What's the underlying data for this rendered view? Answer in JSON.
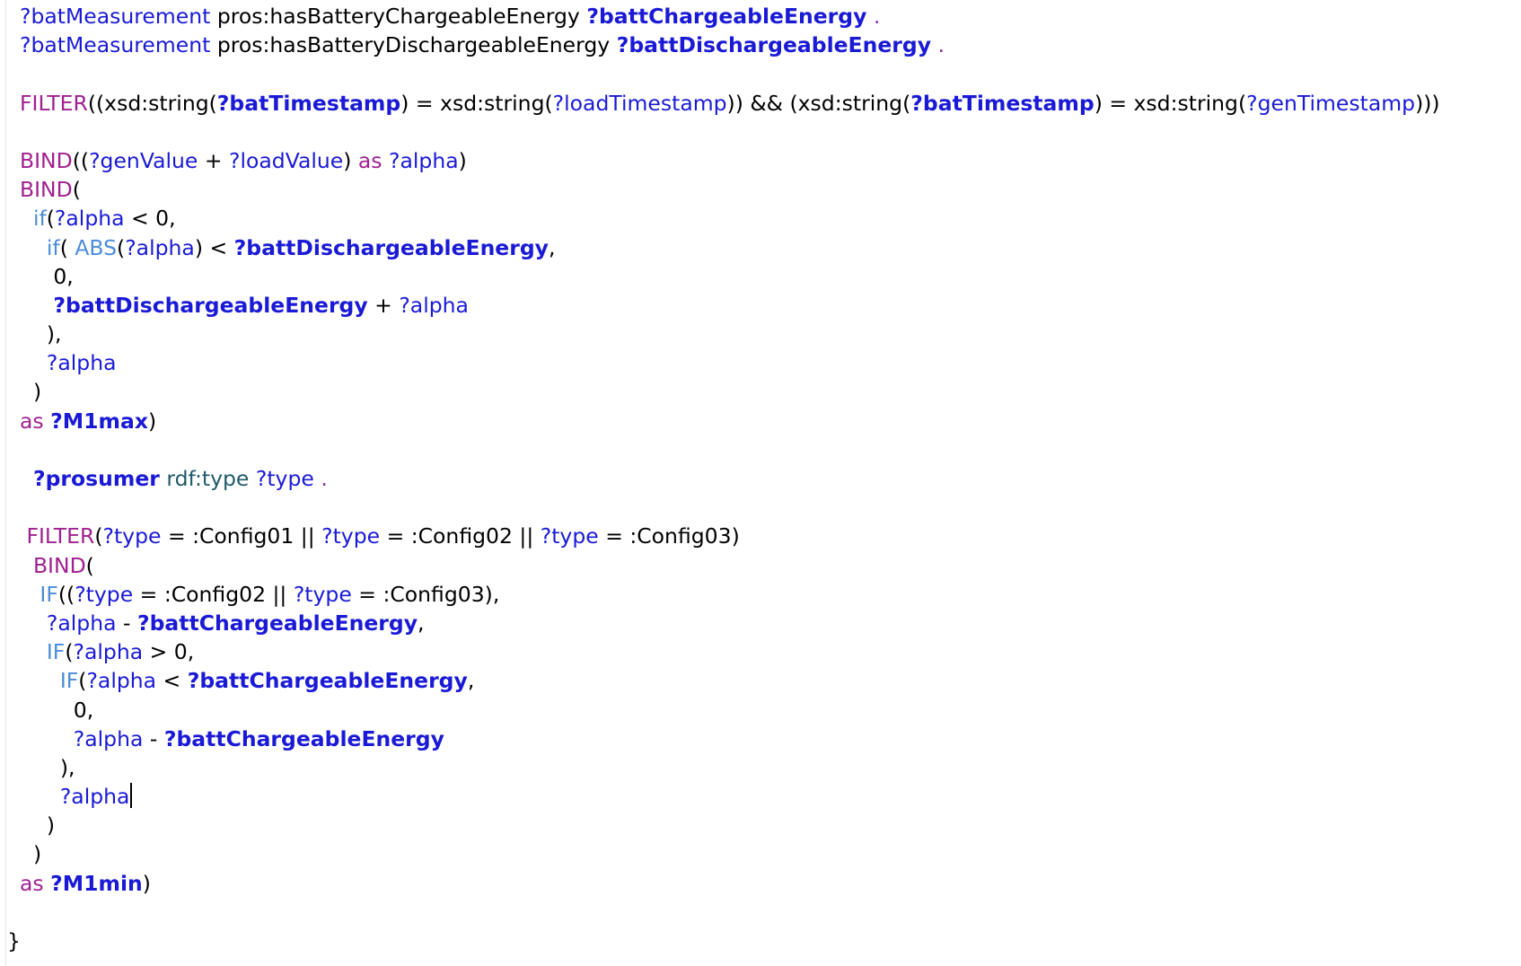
{
  "editor": {
    "lines": [
      [
        {
          "t": "?batMeasurement",
          "c": "pl"
        },
        {
          "t": " pros:hasBatteryChargeableEnergy ",
          "c": "pn"
        },
        {
          "t": "?battChargeableEnergy",
          "c": "bv"
        },
        {
          "t": " .",
          "c": "dot"
        }
      ],
      [
        {
          "t": "?batMeasurement",
          "c": "pl"
        },
        {
          "t": " pros:hasBatteryDischargeableEnergy ",
          "c": "pn"
        },
        {
          "t": "?battDischargeableEnergy",
          "c": "bv"
        },
        {
          "t": " .",
          "c": "dot"
        }
      ],
      [],
      [
        {
          "t": "FILTER",
          "c": "kw"
        },
        {
          "t": "((xsd:string(",
          "c": "pn"
        },
        {
          "t": "?batTimestamp",
          "c": "bv"
        },
        {
          "t": ") = xsd:string(",
          "c": "pn"
        },
        {
          "t": "?loadTimestamp",
          "c": "pl"
        },
        {
          "t": ")) && (xsd:string(",
          "c": "pn"
        },
        {
          "t": "?batTimestamp",
          "c": "bv"
        },
        {
          "t": ") = xsd:string(",
          "c": "pn"
        },
        {
          "t": "?genTimestamp",
          "c": "pl"
        },
        {
          "t": ")))",
          "c": "pn"
        }
      ],
      [],
      [
        {
          "t": "BIND",
          "c": "kw"
        },
        {
          "t": "((",
          "c": "pn"
        },
        {
          "t": "?genValue",
          "c": "pl"
        },
        {
          "t": " + ",
          "c": "pn"
        },
        {
          "t": "?loadValue",
          "c": "pl"
        },
        {
          "t": ") ",
          "c": "pn"
        },
        {
          "t": "as",
          "c": "kw"
        },
        {
          "t": " ",
          "c": "pn"
        },
        {
          "t": "?alpha",
          "c": "pl"
        },
        {
          "t": ")",
          "c": "pn"
        }
      ],
      [
        {
          "t": "BIND",
          "c": "kw"
        },
        {
          "t": "(",
          "c": "pn"
        }
      ],
      [
        {
          "t": "  if",
          "c": "fn"
        },
        {
          "t": "(",
          "c": "pn"
        },
        {
          "t": "?alpha",
          "c": "pl"
        },
        {
          "t": " < 0,",
          "c": "pn"
        }
      ],
      [
        {
          "t": "    if",
          "c": "fn"
        },
        {
          "t": "( ",
          "c": "pn"
        },
        {
          "t": "ABS",
          "c": "fn"
        },
        {
          "t": "(",
          "c": "pn"
        },
        {
          "t": "?alpha",
          "c": "pl"
        },
        {
          "t": ") < ",
          "c": "pn"
        },
        {
          "t": "?battDischargeableEnergy",
          "c": "bv"
        },
        {
          "t": ",",
          "c": "pn"
        }
      ],
      [
        {
          "t": "     0,",
          "c": "pn"
        }
      ],
      [
        {
          "t": "     ",
          "c": "pn"
        },
        {
          "t": "?battDischargeableEnergy",
          "c": "bv"
        },
        {
          "t": " + ",
          "c": "pn"
        },
        {
          "t": "?alpha",
          "c": "pl"
        }
      ],
      [
        {
          "t": "    ),",
          "c": "pn"
        }
      ],
      [
        {
          "t": "    ",
          "c": "pn"
        },
        {
          "t": "?alpha",
          "c": "pl"
        }
      ],
      [
        {
          "t": "  )",
          "c": "pn"
        }
      ],
      [
        {
          "t": "as",
          "c": "kw"
        },
        {
          "t": " ",
          "c": "pn"
        },
        {
          "t": "?M1max",
          "c": "bv"
        },
        {
          "t": ")",
          "c": "pn"
        }
      ],
      [],
      [
        {
          "t": "  ",
          "c": "pn"
        },
        {
          "t": "?prosumer",
          "c": "bv"
        },
        {
          "t": " ",
          "c": "pn"
        },
        {
          "t": "rdf:type",
          "c": "pr"
        },
        {
          "t": " ",
          "c": "pn"
        },
        {
          "t": "?type",
          "c": "pl"
        },
        {
          "t": " .",
          "c": "dot"
        }
      ],
      [],
      [
        {
          "t": " FILTER",
          "c": "kw"
        },
        {
          "t": "(",
          "c": "pn"
        },
        {
          "t": "?type",
          "c": "pl"
        },
        {
          "t": " = :Config01 || ",
          "c": "pn"
        },
        {
          "t": "?type",
          "c": "pl"
        },
        {
          "t": " = :Config02 || ",
          "c": "pn"
        },
        {
          "t": "?type",
          "c": "pl"
        },
        {
          "t": " = :Config03)",
          "c": "pn"
        }
      ],
      [
        {
          "t": "  BIND",
          "c": "kw"
        },
        {
          "t": "(",
          "c": "pn"
        }
      ],
      [
        {
          "t": "   IF",
          "c": "fn"
        },
        {
          "t": "((",
          "c": "pn"
        },
        {
          "t": "?type",
          "c": "pl"
        },
        {
          "t": " = :Config02 || ",
          "c": "pn"
        },
        {
          "t": "?type",
          "c": "pl"
        },
        {
          "t": " = :Config03),",
          "c": "pn"
        }
      ],
      [
        {
          "t": "    ",
          "c": "pn"
        },
        {
          "t": "?alpha",
          "c": "pl"
        },
        {
          "t": " - ",
          "c": "pn"
        },
        {
          "t": "?battChargeableEnergy",
          "c": "bv"
        },
        {
          "t": ",",
          "c": "pn"
        }
      ],
      [
        {
          "t": "    IF",
          "c": "fn"
        },
        {
          "t": "(",
          "c": "pn"
        },
        {
          "t": "?alpha",
          "c": "pl"
        },
        {
          "t": " > 0,",
          "c": "pn"
        }
      ],
      [
        {
          "t": "      IF",
          "c": "fn"
        },
        {
          "t": "(",
          "c": "pn"
        },
        {
          "t": "?alpha",
          "c": "pl"
        },
        {
          "t": " < ",
          "c": "pn"
        },
        {
          "t": "?battChargeableEnergy",
          "c": "bv"
        },
        {
          "t": ",",
          "c": "pn"
        }
      ],
      [
        {
          "t": "        0,",
          "c": "pn"
        }
      ],
      [
        {
          "t": "        ",
          "c": "pn"
        },
        {
          "t": "?alpha",
          "c": "pl"
        },
        {
          "t": " - ",
          "c": "pn"
        },
        {
          "t": "?battChargeableEnergy",
          "c": "bv"
        }
      ],
      [
        {
          "t": "      ),",
          "c": "pn"
        }
      ],
      [
        {
          "t": "      ",
          "c": "pn"
        },
        {
          "t": "?alpha",
          "c": "pl"
        },
        {
          "t": "",
          "c": "caret"
        }
      ],
      [
        {
          "t": "    )",
          "c": "pn"
        }
      ],
      [
        {
          "t": "  )",
          "c": "pn"
        }
      ],
      [
        {
          "t": "as",
          "c": "kw"
        },
        {
          "t": " ",
          "c": "pn"
        },
        {
          "t": "?M1min",
          "c": "bv"
        },
        {
          "t": ")",
          "c": "pn"
        }
      ],
      [],
      [
        {
          "t": "}",
          "c": "pn"
        }
      ]
    ],
    "colors": {
      "variable": "#1a1ad6",
      "keyword": "#a0208f",
      "function": "#4a8cd9",
      "predicate": "#1f5a6b",
      "text": "#000000",
      "background": "#ffffff"
    }
  }
}
